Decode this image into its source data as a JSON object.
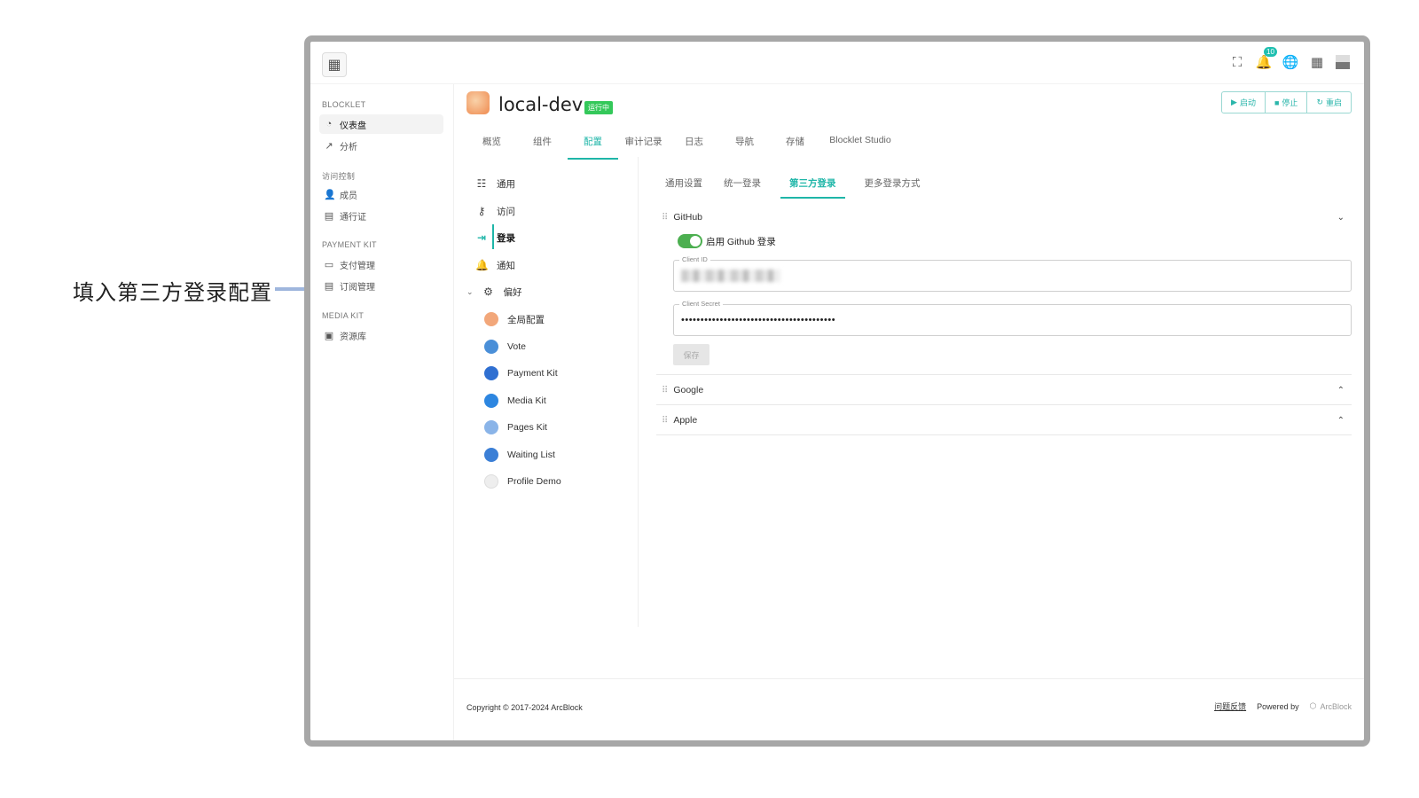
{
  "annotation": {
    "text": "填入第三方登录配置"
  },
  "topbar": {
    "logo": "▦",
    "icons": [
      {
        "name": "fullscreen-icon",
        "glyph": "⛶"
      },
      {
        "name": "bell-icon",
        "glyph": "🔔",
        "badge": "10"
      },
      {
        "name": "globe-icon",
        "glyph": "🌐"
      },
      {
        "name": "grid-icon",
        "glyph": "▦"
      }
    ]
  },
  "sidebar": {
    "groups": [
      {
        "title": "BLOCKLET",
        "items": [
          {
            "label": "仪表盘",
            "icon": "◔"
          },
          {
            "label": "分析",
            "icon": "↗"
          }
        ]
      },
      {
        "title": "访问控制",
        "items": [
          {
            "label": "成员",
            "icon": "👤"
          },
          {
            "label": "通行证",
            "icon": "▤"
          }
        ]
      },
      {
        "title": "PAYMENT KIT",
        "items": [
          {
            "label": "支付管理",
            "icon": "▭"
          },
          {
            "label": "订阅管理",
            "icon": "▤"
          }
        ]
      },
      {
        "title": "MEDIA KIT",
        "items": [
          {
            "label": "资源库",
            "icon": "▣"
          }
        ]
      }
    ]
  },
  "header": {
    "title": "local-dev",
    "status": "运行中",
    "actions": [
      {
        "icon": "▶",
        "label": "启动"
      },
      {
        "icon": "■",
        "label": "停止"
      },
      {
        "icon": "↻",
        "label": "重启"
      }
    ]
  },
  "tabs": [
    "概览",
    "组件",
    "配置",
    "审计记录",
    "日志",
    "导航",
    "存储",
    "Blocklet Studio"
  ],
  "settings_menu": {
    "items": [
      {
        "label": "通用",
        "icon": "☷"
      },
      {
        "label": "访问",
        "icon": "⚷"
      },
      {
        "label": "登录",
        "icon": "⇥"
      },
      {
        "label": "通知",
        "icon": "🔔"
      },
      {
        "label": "偏好",
        "icon": "⚙",
        "caret": "⌄"
      }
    ],
    "components": [
      {
        "label": "全局配置",
        "color": "#f2a77a"
      },
      {
        "label": "Vote",
        "color": "#4a8fd8"
      },
      {
        "label": "Payment Kit",
        "color": "#2f6fd1"
      },
      {
        "label": "Media Kit",
        "color": "#2d86e0"
      },
      {
        "label": "Pages Kit",
        "color": "#8ab4e8"
      },
      {
        "label": "Waiting List",
        "color": "#3b7fd6"
      },
      {
        "label": "Profile Demo",
        "color": "#e8e8e8"
      }
    ]
  },
  "subtabs": [
    "通用设置",
    "统一登录",
    "第三方登录",
    "更多登录方式"
  ],
  "providers": {
    "github": {
      "name": "GitHub",
      "toggle_label": "启用 Github 登录",
      "client_id_label": "Client ID",
      "client_secret_label": "Client Secret",
      "client_secret_value": "••••••••••••••••••••••••••••••••••••••••",
      "save_label": "保存"
    },
    "google": {
      "name": "Google"
    },
    "apple": {
      "name": "Apple"
    }
  },
  "footer": {
    "copyright": "Copyright © 2017-2024 ArcBlock",
    "feedback": "问题反馈",
    "powered": "Powered by",
    "brand": "ArcBlock"
  }
}
